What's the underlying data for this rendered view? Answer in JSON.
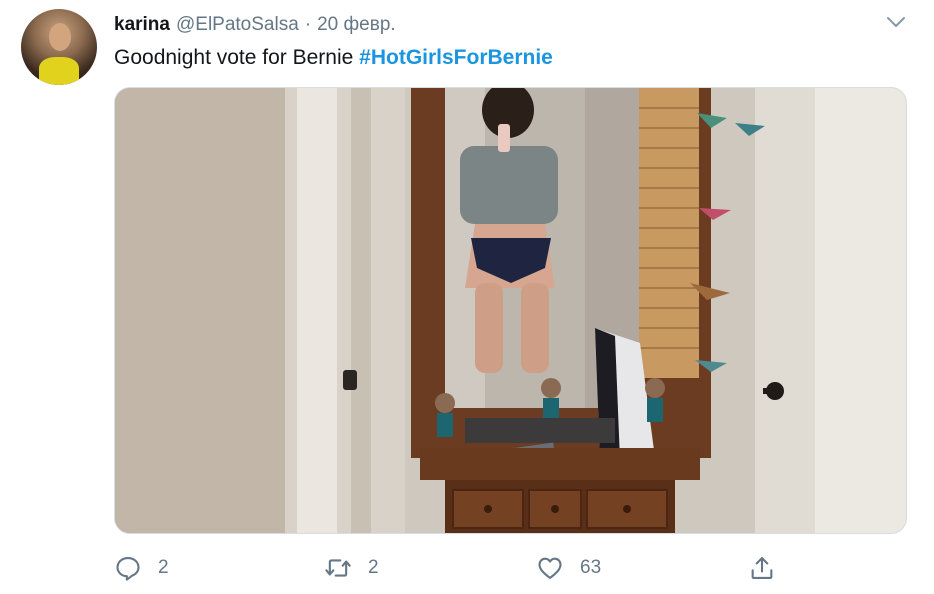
{
  "tweet": {
    "author_name": "karina",
    "author_handle": "@ElPatoSalsa",
    "separator": "·",
    "date": "20 февр.",
    "text": "Goodnight vote for Bernie ",
    "hashtag": "#HotGirlsForBernie"
  },
  "media": {
    "kind": "photo",
    "alt": "Mirror selfie photo"
  },
  "actions": {
    "reply_count": "2",
    "retweet_count": "2",
    "like_count": "63"
  },
  "icons": {
    "menu": "chevron-down-icon",
    "reply": "reply-icon",
    "retweet": "retweet-icon",
    "like": "heart-icon",
    "share": "share-icon"
  },
  "colors": {
    "text": "#14171a",
    "muted": "#657786",
    "link": "#1b95e0",
    "border": "#d7dee2"
  }
}
